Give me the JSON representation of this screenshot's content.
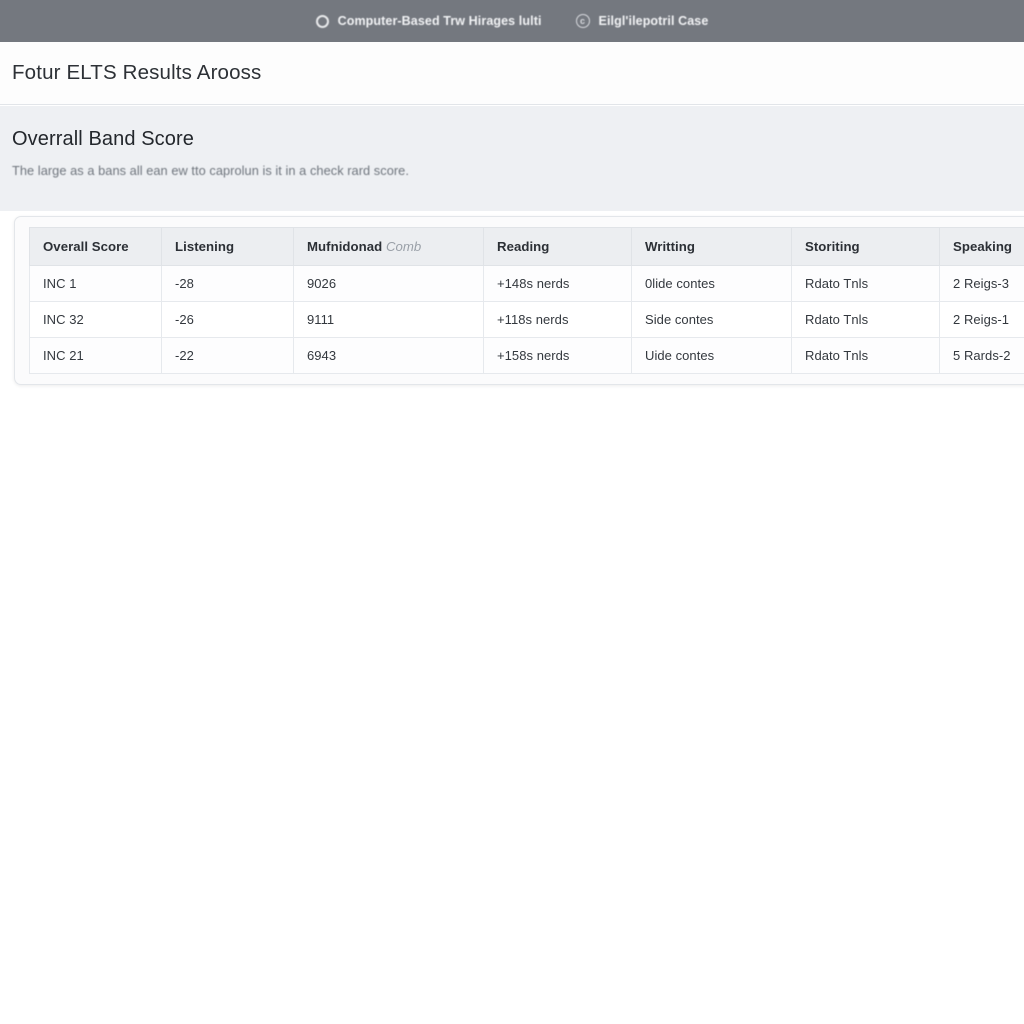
{
  "topbar": {
    "items": [
      {
        "icon": "circle-outline-icon",
        "label": "Computer-Based Trw Hirages lulti"
      },
      {
        "icon": "copyright-circle-icon",
        "glyph": "c",
        "label": "Eilgl'ilepotril Case"
      }
    ]
  },
  "header": {
    "page_title": "Fotur ELTS Results Arooss"
  },
  "section": {
    "title": "Overrall Band Score",
    "subtitle": "The large as a bans all ean ew tto caprolun is it in a check rard score."
  },
  "table": {
    "columns": [
      {
        "label": "Overall Score"
      },
      {
        "label": "Listening"
      },
      {
        "label": "Mufnidonad",
        "muted": "Comb"
      },
      {
        "label": "Reading"
      },
      {
        "label": "Writting"
      },
      {
        "label": "Storiting"
      },
      {
        "label": "Speaking"
      }
    ],
    "rows": [
      {
        "overall": "INC 1",
        "listening": "-28",
        "multi": "9026",
        "reading": "+148s nerds",
        "writing": "0lide contes",
        "storiting": "Rdato Tnls",
        "speaking": "2 Reigs-3"
      },
      {
        "overall": "INC 32",
        "listening": "-26",
        "multi": "9111",
        "reading": "+118s nerds",
        "writing": "Side contes",
        "storiting": "Rdato Tnls",
        "speaking": "2 Reigs-1"
      },
      {
        "overall": "INC 21",
        "listening": "-22",
        "multi": "6943",
        "reading": "+158s nerds",
        "writing": "Uide contes",
        "storiting": "Rdato Tnls",
        "speaking": "5 Rards-2"
      }
    ]
  },
  "colors": {
    "topbar_bg": "#74787f",
    "section_bg": "#eef0f3",
    "table_header_bg": "#eceef1",
    "text_primary": "#2c3036",
    "text_muted": "#6f757d"
  }
}
